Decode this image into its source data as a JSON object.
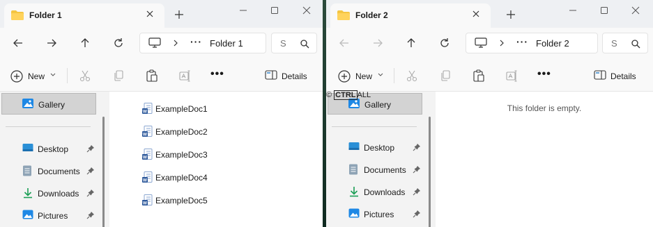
{
  "windows": [
    {
      "tab_title": "Folder 1",
      "breadcrumb": "Folder 1",
      "search_placeholder": "S",
      "toolbar": {
        "new_label": "New",
        "details_label": "Details"
      },
      "sidebar": {
        "gallery": "Gallery",
        "items": [
          {
            "label": "Desktop",
            "icon": "desktop-icon"
          },
          {
            "label": "Documents",
            "icon": "documents-icon"
          },
          {
            "label": "Downloads",
            "icon": "downloads-icon"
          },
          {
            "label": "Pictures",
            "icon": "pictures-icon"
          }
        ]
      },
      "files": [
        "ExampleDoc1",
        "ExampleDoc2",
        "ExampleDoc3",
        "ExampleDoc4",
        "ExampleDoc5"
      ]
    },
    {
      "tab_title": "Folder 2",
      "breadcrumb": "Folder 2",
      "search_placeholder": "S",
      "toolbar": {
        "new_label": "New",
        "details_label": "Details"
      },
      "sidebar": {
        "gallery": "Gallery",
        "items": [
          {
            "label": "Desktop",
            "icon": "desktop-icon"
          },
          {
            "label": "Documents",
            "icon": "documents-icon"
          },
          {
            "label": "Downloads",
            "icon": "downloads-icon"
          },
          {
            "label": "Pictures",
            "icon": "pictures-icon"
          }
        ]
      },
      "empty_message": "This folder is empty."
    }
  ],
  "watermark": {
    "prefix": "©",
    "box": "CTRL",
    "suffix": "ALL"
  },
  "colors": {
    "folder": "#f4c542",
    "word_blue": "#2b579a",
    "accent": "#0067c0",
    "downloads": "#1a9e54"
  }
}
